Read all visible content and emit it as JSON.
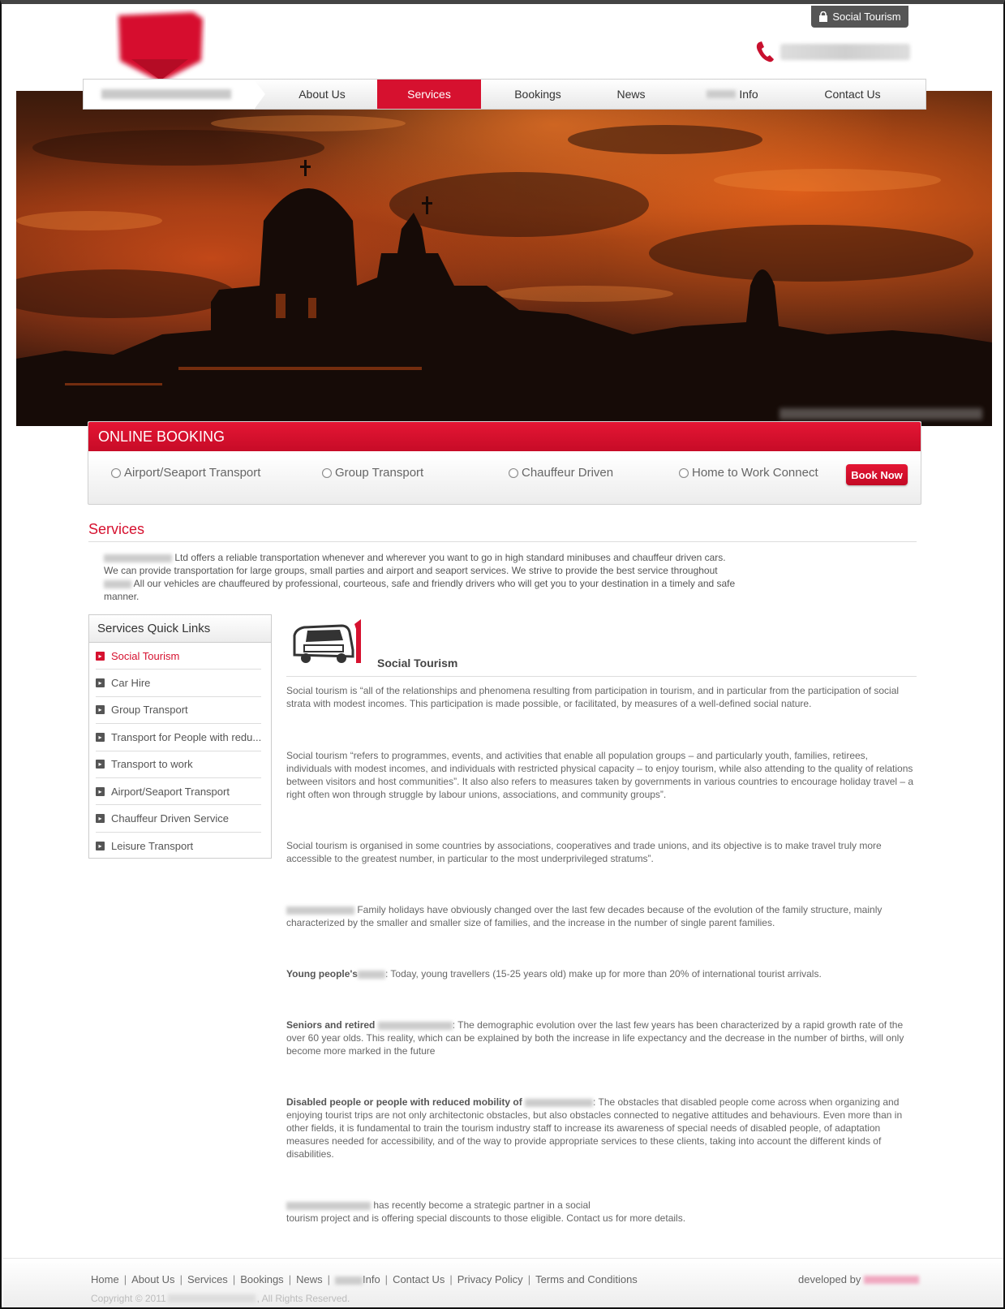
{
  "top_tab": {
    "label": "Social Tourism"
  },
  "nav": {
    "items": [
      {
        "label": "About Us"
      },
      {
        "label": "Services"
      },
      {
        "label": "Bookings"
      },
      {
        "label": "News"
      },
      {
        "label": "Info"
      },
      {
        "label": "Contact Us"
      }
    ],
    "active": "Services"
  },
  "booking": {
    "title": "ONLINE BOOKING",
    "options": [
      "Airport/Seaport Transport",
      "Group Transport",
      "Chauffeur Driven",
      "Home to Work Connect"
    ],
    "button": "Book Now"
  },
  "services": {
    "title": "Services",
    "intro_1": "Ltd offers a reliable transportation whenever and wherever you want to go in high standard minibuses and chauffeur driven cars. We can provide transportation for large groups, small parties and airport and seaport services. We strive to provide the best service throughout",
    "intro_2": "All our vehicles are chauffeured by professional, courteous, safe and friendly drivers who will get you to your destination in a timely and safe manner."
  },
  "quick_links": {
    "title": "Services Quick Links",
    "items": [
      "Social Tourism",
      "Car Hire",
      "Group Transport",
      "Transport for People with redu...",
      "Transport to work",
      "Airport/Seaport Transport",
      "Chauffeur Driven Service",
      "Leisure Transport"
    ]
  },
  "article": {
    "title": "Social Tourism",
    "p1": "Social tourism is “all of the relationships and phenomena resulting from participation in tourism, and in particular from the participation of social strata with modest incomes. This participation is made possible, or facilitated, by measures of a well-defined social nature.",
    "p2": "Social tourism “refers to programmes, events, and activities that enable all population groups – and particularly youth, families, retirees, individuals with modest incomes, and individuals with restricted physical capacity – to enjoy tourism, while also attending to the quality of relations between visitors and host communities”. It also also refers to measures taken by governments in various countries to encourage holiday travel – a right often won through struggle by labour unions, associations, and community groups”.",
    "p3": "Social tourism is organised in some countries by associations, cooperatives and trade unions, and its objective is to make travel truly more accessible to the greatest number, in particular to the most underprivileged stratums”.",
    "p4": "Family holidays have obviously changed over the last few decades because of the evolution of the family structure, mainly characterized by the smaller and smaller size of families, and the increase in the number of single parent families.",
    "p5_bold": "Young people's",
    "p5": ": Today, young travellers (15-25 years old) make up for more than 20% of international tourist arrivals.",
    "p6_bold": "Seniors and retired",
    "p6": ": The demographic evolution over the last few years has been characterized by a rapid growth rate of the over 60 year olds. This reality, which can be explained by both the increase in life expectancy and the decrease in the number of births, will only become more marked in the future",
    "p7_bold": "Disabled people or people with reduced mobility of",
    "p7": ": The obstacles that disabled people come across when organizing and enjoying tourist trips are not only architectonic obstacles, but also obstacles connected to negative attitudes and behaviours. Even more than in other fields, it is fundamental to train the tourism industry staff to increase its awareness of special needs of disabled people, of adaptation measures needed for accessibility, and of the way to provide appropriate services to these clients, taking into account the different kinds of disabilities.",
    "p8a": "has recently become a strategic partner in a social",
    "p8b": "tourism project and is offering special discounts to those eligible. Contact us for more details."
  },
  "footer": {
    "links": [
      "Home",
      "About Us",
      "Services",
      "Bookings",
      "News",
      "Info",
      "Contact Us",
      "Privacy Policy",
      "Terms and Conditions"
    ],
    "developed_by": "developed by",
    "copyright_prefix": "Copyright © 2011",
    "copyright_suffix": ", All Rights Reserved."
  },
  "colors": {
    "accent": "#d6112f",
    "nav_text": "#333333",
    "body_text": "#666666"
  }
}
